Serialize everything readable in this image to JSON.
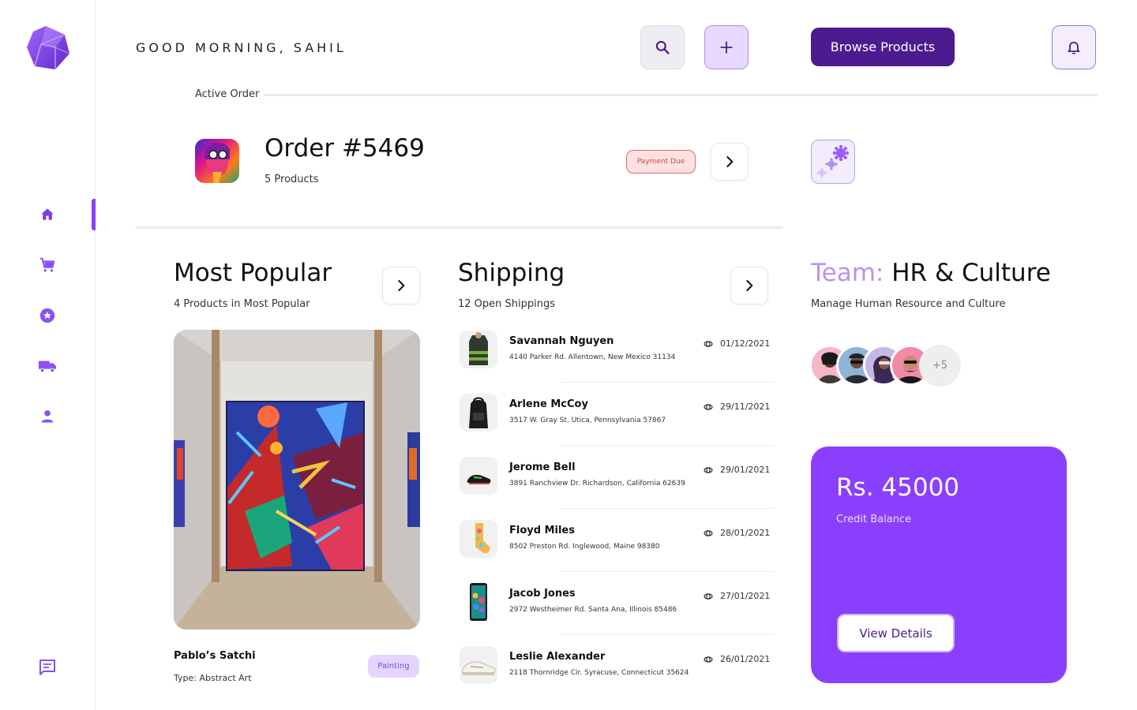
{
  "header": {
    "greeting": "GOOD MORNING, SAHIL",
    "browse_label": "Browse Products"
  },
  "icons": {
    "logo": "hexagon-logo-icon",
    "nav": [
      "home-icon",
      "cart-icon",
      "star-badge-icon",
      "truck-icon",
      "user-icon"
    ],
    "chat": "chat-bubble-icon",
    "search": "search-icon",
    "add": "plus-icon",
    "notifications": "bell-icon",
    "settings": "gear-cluster-icon"
  },
  "active_order": {
    "section_label": "Active Order",
    "title": "Order #5469",
    "subtitle": "5 Products",
    "status": "Payment Due"
  },
  "most_popular": {
    "title": "Most Popular",
    "subtitle": "4 Products in Most Popular",
    "product_name": "Pablo’s Satchi",
    "product_type": "Type: Abstract Art",
    "badge": "Painting"
  },
  "shipping": {
    "title": "Shipping",
    "subtitle": "12 Open Shippings",
    "items": [
      {
        "name": "Savannah Nguyen",
        "address": "4140 Parker Rd. Allentown, New Mexico 31134",
        "date": "01/12/2021"
      },
      {
        "name": "Arlene McCoy",
        "address": "3517 W. Gray St. Utica, Pennsylvania 57867",
        "date": "29/11/2021"
      },
      {
        "name": "Jerome Bell",
        "address": "3891 Ranchview Dr. Richardson, California 62639",
        "date": "29/01/2021"
      },
      {
        "name": "Floyd Miles",
        "address": "8502 Preston Rd. Inglewood, Maine 98380",
        "date": "28/01/2021"
      },
      {
        "name": "Jacob Jones",
        "address": "2972 Westheimer Rd. Santa Ana, Illinois 85486",
        "date": "27/01/2021"
      },
      {
        "name": "Leslie Alexander",
        "address": "2118 Thornridge Cir. Syracuse, Connecticut 35624",
        "date": "26/01/2021"
      }
    ]
  },
  "team": {
    "prefix": "Team:",
    "name": "HR & Culture",
    "subtitle": "Manage Human Resource and Culture",
    "more": "+5"
  },
  "credit": {
    "amount": "Rs. 45000",
    "label": "Credit Balance",
    "button": "View Details"
  },
  "colors": {
    "primary": "#8a3ffc",
    "dark_primary": "#4b1b8f",
    "accent_light": "#b894f2",
    "alert": "#c94848"
  }
}
